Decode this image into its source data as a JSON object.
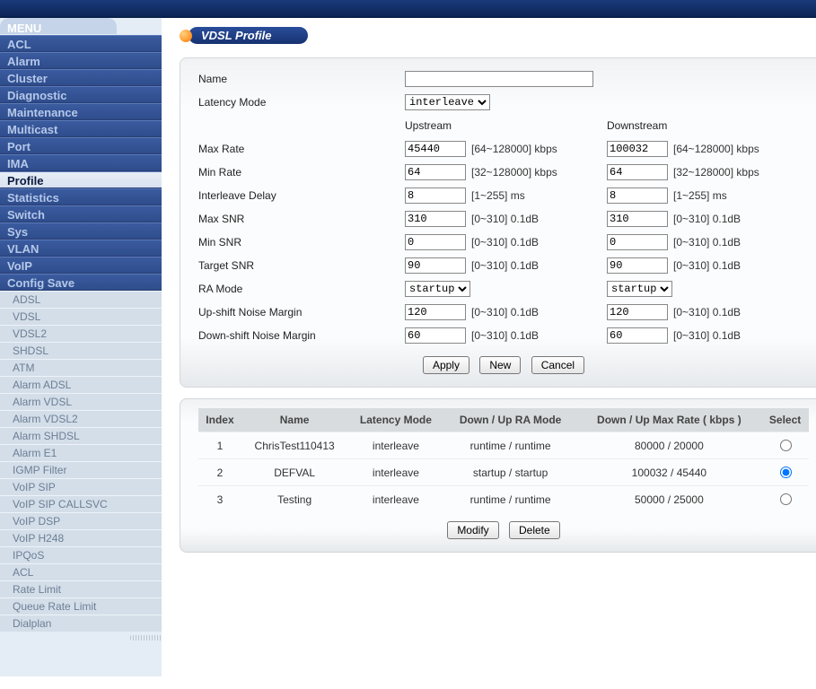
{
  "menu": {
    "header": "MENU",
    "main": [
      {
        "id": "acl",
        "label": "ACL"
      },
      {
        "id": "alarm",
        "label": "Alarm"
      },
      {
        "id": "cluster",
        "label": "Cluster"
      },
      {
        "id": "diagnostic",
        "label": "Diagnostic"
      },
      {
        "id": "maintenance",
        "label": "Maintenance"
      },
      {
        "id": "multicast",
        "label": "Multicast"
      },
      {
        "id": "port",
        "label": "Port"
      },
      {
        "id": "ima",
        "label": "IMA"
      },
      {
        "id": "profile",
        "label": "Profile",
        "active": true
      },
      {
        "id": "statistics",
        "label": "Statistics"
      },
      {
        "id": "switch",
        "label": "Switch"
      },
      {
        "id": "sys",
        "label": "Sys"
      },
      {
        "id": "vlan",
        "label": "VLAN"
      },
      {
        "id": "voip",
        "label": "VoIP"
      },
      {
        "id": "config-save",
        "label": "Config Save"
      }
    ],
    "sub": [
      {
        "id": "adsl",
        "label": "ADSL"
      },
      {
        "id": "vdsl",
        "label": "VDSL"
      },
      {
        "id": "vdsl2",
        "label": "VDSL2"
      },
      {
        "id": "shdsl",
        "label": "SHDSL"
      },
      {
        "id": "atm",
        "label": "ATM"
      },
      {
        "id": "alarm-adsl",
        "label": "Alarm ADSL"
      },
      {
        "id": "alarm-vdsl",
        "label": "Alarm VDSL"
      },
      {
        "id": "alarm-vdsl2",
        "label": "Alarm VDSL2"
      },
      {
        "id": "alarm-shdsl",
        "label": "Alarm SHDSL"
      },
      {
        "id": "alarm-e1",
        "label": "Alarm E1"
      },
      {
        "id": "igmp-filter",
        "label": "IGMP Filter"
      },
      {
        "id": "voip-sip",
        "label": "VoIP SIP"
      },
      {
        "id": "voip-sip-callsvc",
        "label": "VoIP SIP CALLSVC"
      },
      {
        "id": "voip-dsp",
        "label": "VoIP DSP"
      },
      {
        "id": "voip-h248",
        "label": "VoIP H248"
      },
      {
        "id": "ipqos",
        "label": "IPQoS"
      },
      {
        "id": "acl-sub",
        "label": "ACL"
      },
      {
        "id": "rate-limit",
        "label": "Rate Limit"
      },
      {
        "id": "queue-rate-limit",
        "label": "Queue Rate Limit"
      },
      {
        "id": "dialplan",
        "label": "Dialplan"
      }
    ]
  },
  "page": {
    "title": "VDSL Profile"
  },
  "form": {
    "labels": {
      "name": "Name",
      "latency_mode": "Latency Mode",
      "upstream": "Upstream",
      "downstream": "Downstream",
      "max_rate": "Max Rate",
      "min_rate": "Min Rate",
      "interleave_delay": "Interleave Delay",
      "max_snr": "Max SNR",
      "min_snr": "Min SNR",
      "target_snr": "Target SNR",
      "ra_mode": "RA Mode",
      "up_shift": "Up-shift Noise Margin",
      "down_shift": "Down-shift Noise Margin"
    },
    "hints": {
      "rate_max": "[64~128000] kbps",
      "rate_min": "[32~128000] kbps",
      "delay": "[1~255] ms",
      "snr": "[0~310] 0.1dB"
    },
    "values": {
      "name": "",
      "latency_mode": "interleave",
      "up_max_rate": "45440",
      "down_max_rate": "100032",
      "up_min_rate": "64",
      "down_min_rate": "64",
      "up_delay": "8",
      "down_delay": "8",
      "up_max_snr": "310",
      "down_max_snr": "310",
      "up_min_snr": "0",
      "down_min_snr": "0",
      "up_target_snr": "90",
      "down_target_snr": "90",
      "up_ra_mode": "startup",
      "down_ra_mode": "startup",
      "up_upshift": "120",
      "down_upshift": "120",
      "up_downshift": "60",
      "down_downshift": "60"
    },
    "buttons": {
      "apply": "Apply",
      "new": "New",
      "cancel": "Cancel",
      "modify": "Modify",
      "delete": "Delete"
    }
  },
  "table": {
    "headers": {
      "index": "Index",
      "name": "Name",
      "latency": "Latency Mode",
      "ra": "Down / Up RA Mode",
      "maxrate": "Down / Up Max Rate ( kbps )",
      "select": "Select"
    },
    "rows": [
      {
        "index": "1",
        "name": "ChrisTest110413",
        "latency": "interleave",
        "ra": "runtime / runtime",
        "maxrate": "80000 / 20000",
        "selected": false
      },
      {
        "index": "2",
        "name": "DEFVAL",
        "latency": "interleave",
        "ra": "startup / startup",
        "maxrate": "100032 / 45440",
        "selected": true
      },
      {
        "index": "3",
        "name": "Testing",
        "latency": "interleave",
        "ra": "runtime / runtime",
        "maxrate": "50000 / 25000",
        "selected": false
      }
    ]
  }
}
